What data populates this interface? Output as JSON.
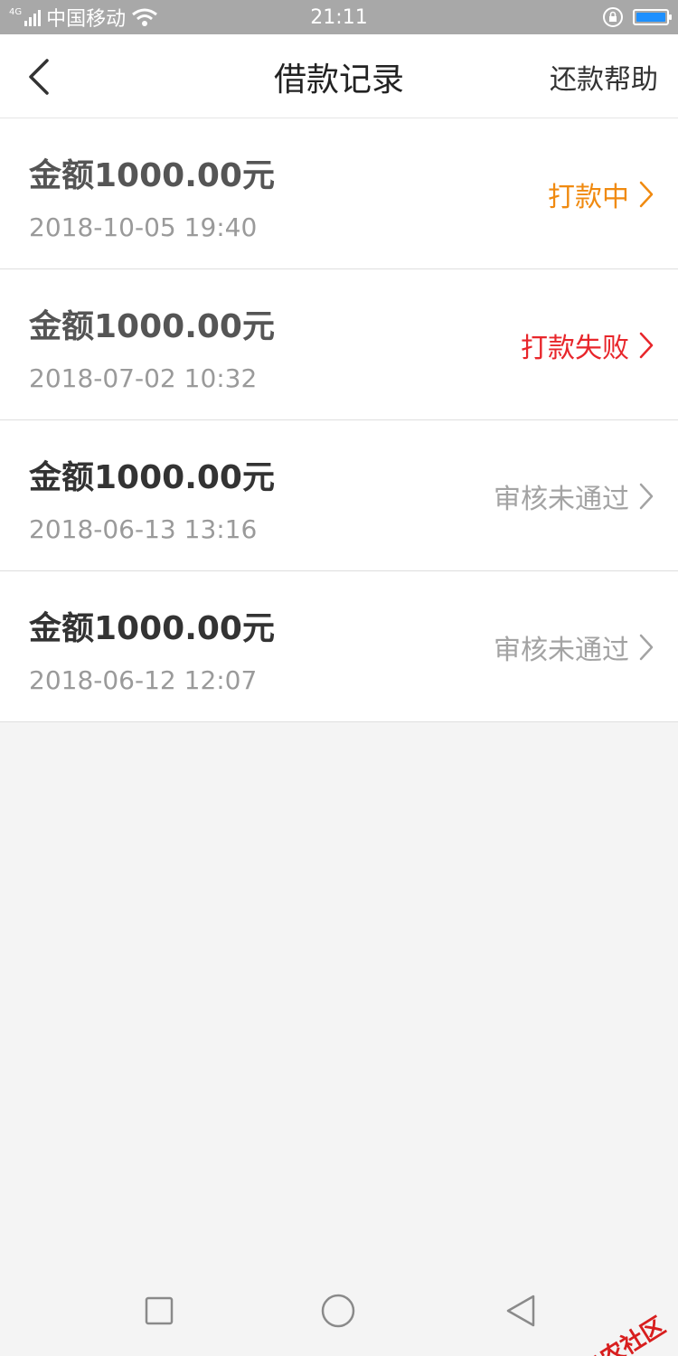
{
  "status_bar": {
    "network": "4G",
    "carrier": "中国移动",
    "time": "21:11"
  },
  "header": {
    "title": "借款记录",
    "help_label": "还款帮助"
  },
  "records": [
    {
      "amount": "金额1000.00元",
      "time": "2018-10-05 19:40",
      "status": "打款中",
      "status_color": "#f08a10",
      "amount_color": "#555555"
    },
    {
      "amount": "金额1000.00元",
      "time": "2018-07-02 10:32",
      "status": "打款失败",
      "status_color": "#e8262b",
      "amount_color": "#555555"
    },
    {
      "amount": "金额1000.00元",
      "time": "2018-06-13 13:16",
      "status": "审核未通过",
      "status_color": "#a3a3a3",
      "amount_color": "#333333"
    },
    {
      "amount": "金额1000.00元",
      "time": "2018-06-12 12:07",
      "status": "审核未通过",
      "status_color": "#a3a3a3",
      "amount_color": "#333333"
    }
  ],
  "watermark": "卡农社区"
}
